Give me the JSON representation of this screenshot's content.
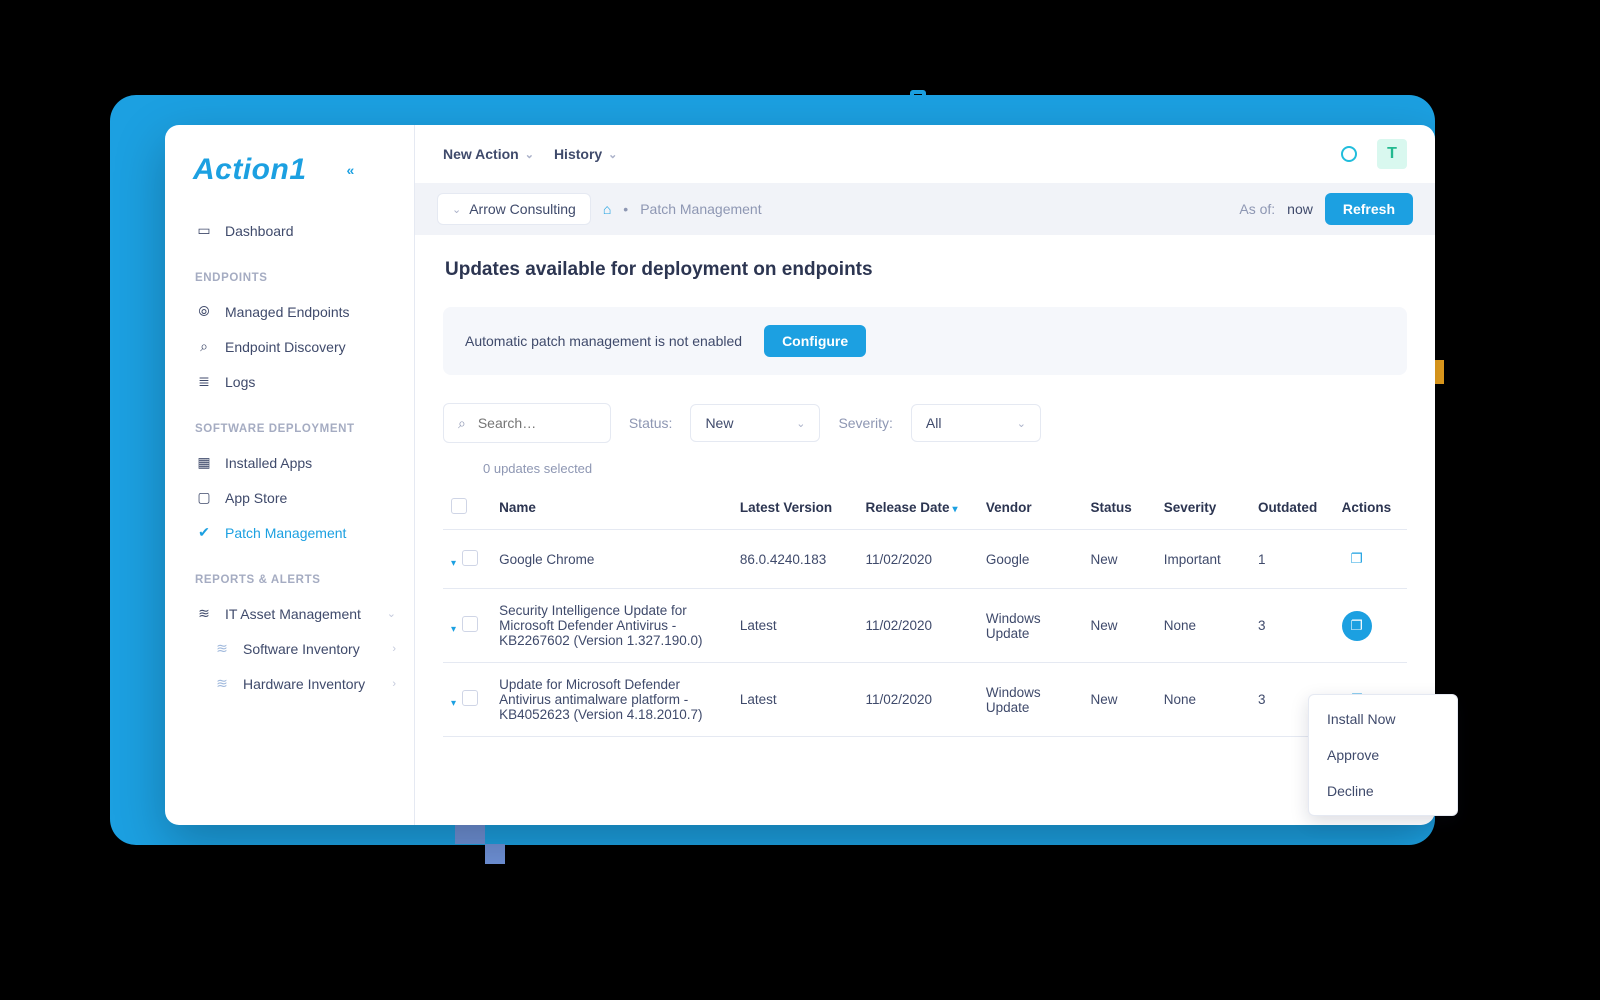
{
  "brand": "Action1",
  "collapse_glyph": "«",
  "topbar": {
    "new_action": "New Action",
    "history": "History",
    "avatar_initial": "T"
  },
  "breadcrumb": {
    "org": "Arrow Consulting",
    "page": "Patch Management",
    "as_of_label": "As of:",
    "as_of_value": "now",
    "refresh": "Refresh"
  },
  "sidebar": {
    "dashboard": "Dashboard",
    "sect_endpoints": "ENDPOINTS",
    "managed": "Managed Endpoints",
    "discovery": "Endpoint Discovery",
    "logs": "Logs",
    "sect_deploy": "SOFTWARE DEPLOYMENT",
    "installed": "Installed Apps",
    "appstore": "App Store",
    "patch": "Patch Management",
    "sect_reports": "REPORTS & ALERTS",
    "it_asset": "IT Asset Management",
    "soft_inv": "Software Inventory",
    "hard_inv": "Hardware Inventory"
  },
  "page": {
    "title": "Updates available for deployment on endpoints",
    "notice": "Automatic patch management is not enabled",
    "configure": "Configure",
    "search_placeholder": "Search…",
    "status_label": "Status:",
    "severity_label": "Severity:",
    "status_value": "New",
    "severity_value": "All",
    "selected_text": "0 updates selected"
  },
  "columns": {
    "name": "Name",
    "version": "Latest Version",
    "release": "Release Date",
    "vendor": "Vendor",
    "status": "Status",
    "severity": "Severity",
    "outdated": "Outdated",
    "actions": "Actions"
  },
  "rows": [
    {
      "name": "Google Chrome",
      "version": "86.0.4240.183",
      "release": "11/02/2020",
      "vendor": "Google",
      "status": "New",
      "severity": "Important",
      "outdated": "1"
    },
    {
      "name": "Security Intelligence Update for Microsoft Defender Antivirus - KB2267602 (Version 1.327.190.0)",
      "version": "Latest",
      "release": "11/02/2020",
      "vendor": "Windows Update",
      "status": "New",
      "severity": "None",
      "outdated": "3"
    },
    {
      "name": "Update for Microsoft Defender Antivirus antimalware platform - KB4052623 (Version 4.18.2010.7)",
      "version": "Latest",
      "release": "11/02/2020",
      "vendor": "Windows Update",
      "status": "New",
      "severity": "None",
      "outdated": "3"
    }
  ],
  "actions_menu": {
    "install": "Install Now",
    "approve": "Approve",
    "decline": "Decline"
  }
}
